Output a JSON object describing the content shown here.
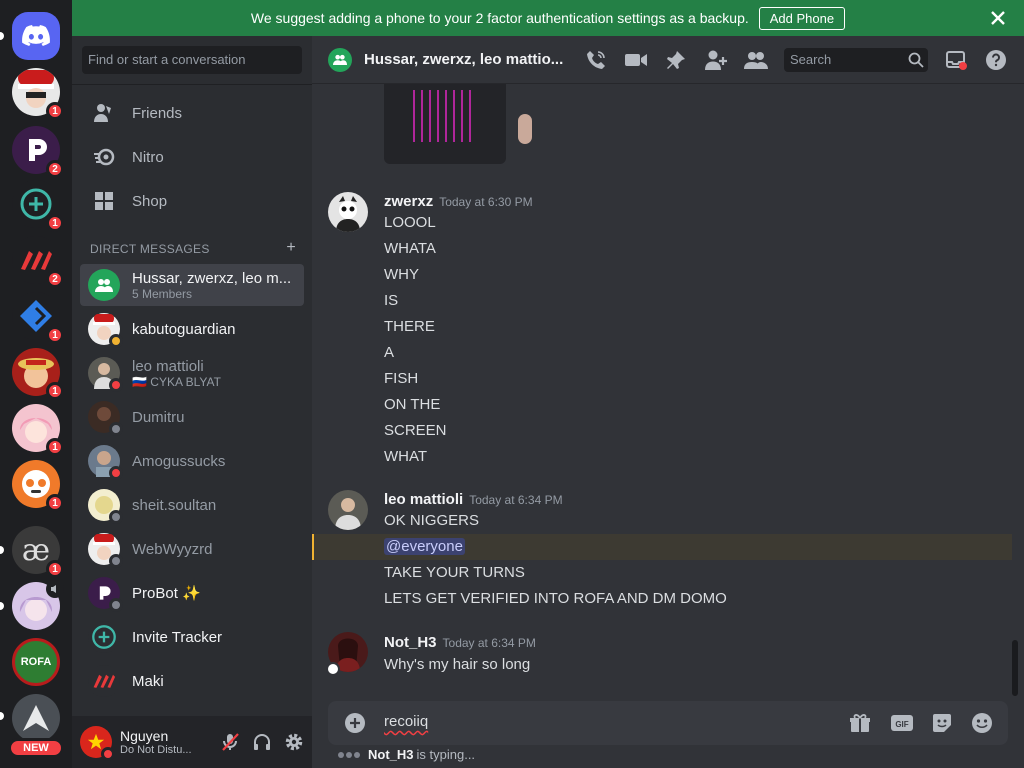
{
  "banner": {
    "text": "We suggest adding a phone to your 2 factor authentication settings as a backup.",
    "button": "Add Phone"
  },
  "servers": [
    {
      "name": "discord-home",
      "badge": null
    },
    {
      "name": "santa-avatar-server",
      "badge": "1"
    },
    {
      "name": "probot-server",
      "badge": "2"
    },
    {
      "name": "invite-tracker-server",
      "badge": "1"
    },
    {
      "name": "maki-server",
      "badge": "2"
    },
    {
      "name": "blue-diamond-server",
      "badge": "1"
    },
    {
      "name": "luffy-server",
      "badge": "1"
    },
    {
      "name": "pink-anime-server",
      "badge": "1"
    },
    {
      "name": "orange-bot-server",
      "badge": "1"
    },
    {
      "name": "ae-server",
      "badge": "1",
      "glyph": "æ"
    },
    {
      "name": "anime-girl-server",
      "badge": null
    },
    {
      "name": "rofa-server",
      "badge": null,
      "glyph": "ROFA"
    },
    {
      "name": "arch-server",
      "badge": null
    }
  ],
  "rail_new_label": "NEW",
  "sidebar": {
    "search_placeholder": "Find or start a conversation",
    "nav": [
      {
        "label": "Friends",
        "icon": "friends-icon"
      },
      {
        "label": "Nitro",
        "icon": "nitro-icon"
      },
      {
        "label": "Shop",
        "icon": "shop-icon"
      }
    ],
    "dm_header": "DIRECT MESSAGES",
    "dms": [
      {
        "name": "Hussar, zwerxz, leo m...",
        "sub": "5 Members",
        "status": "group",
        "active": true
      },
      {
        "name": "kabutoguardian",
        "sub": "",
        "status": "idle",
        "bright": true
      },
      {
        "name": "leo mattioli",
        "sub": "🇷🇺 CYKA BLYAT",
        "status": "dnd"
      },
      {
        "name": "Dumitru",
        "sub": "",
        "status": "offline"
      },
      {
        "name": "Amogussucks",
        "sub": "",
        "status": "dnd"
      },
      {
        "name": "sheit.soultan",
        "sub": "",
        "status": "offline"
      },
      {
        "name": "WebWyyzrd",
        "sub": "",
        "status": "offline"
      },
      {
        "name": "ProBot ✨",
        "sub": "",
        "status": "offline",
        "bright": true
      },
      {
        "name": "Invite Tracker",
        "sub": "",
        "status": "none",
        "bright": true
      },
      {
        "name": "Maki",
        "sub": "",
        "status": "none",
        "bright": true
      }
    ]
  },
  "user": {
    "name": "Nguyen",
    "status": "Do Not Distu..."
  },
  "channel": {
    "title": "Hussar, zwerxz, leo mattio...",
    "search_placeholder": "Search"
  },
  "messages": [
    {
      "author": "zwerxz",
      "timestamp": "Today at 6:30 PM",
      "lines": [
        "LOOOL",
        "WHATA",
        "WHY",
        "IS",
        "THERE",
        "A",
        "FISH",
        "ON THE",
        "SCREEN",
        "WHAT"
      ]
    },
    {
      "author": "leo mattioli",
      "timestamp": "Today at 6:34 PM",
      "lines": [
        "OK NIGGERS",
        "@everyone",
        "TAKE YOUR TURNS",
        "LETS GET VERIFIED INTO ROFA AND DM DOMO"
      ]
    },
    {
      "author": "Not_H3",
      "timestamp": "Today at 6:34 PM",
      "lines": [
        "Why's my hair so long"
      ]
    }
  ],
  "composer": {
    "draft": "recoiiq"
  },
  "typing": {
    "user": "Not_H3",
    "text": "is typing..."
  },
  "colors": {
    "banner": "#248046",
    "rail": "#1e1f22",
    "sidebar": "#2b2d31",
    "chat": "#313338",
    "badge": "#f23f43",
    "mention_bar": "#f0b232"
  }
}
